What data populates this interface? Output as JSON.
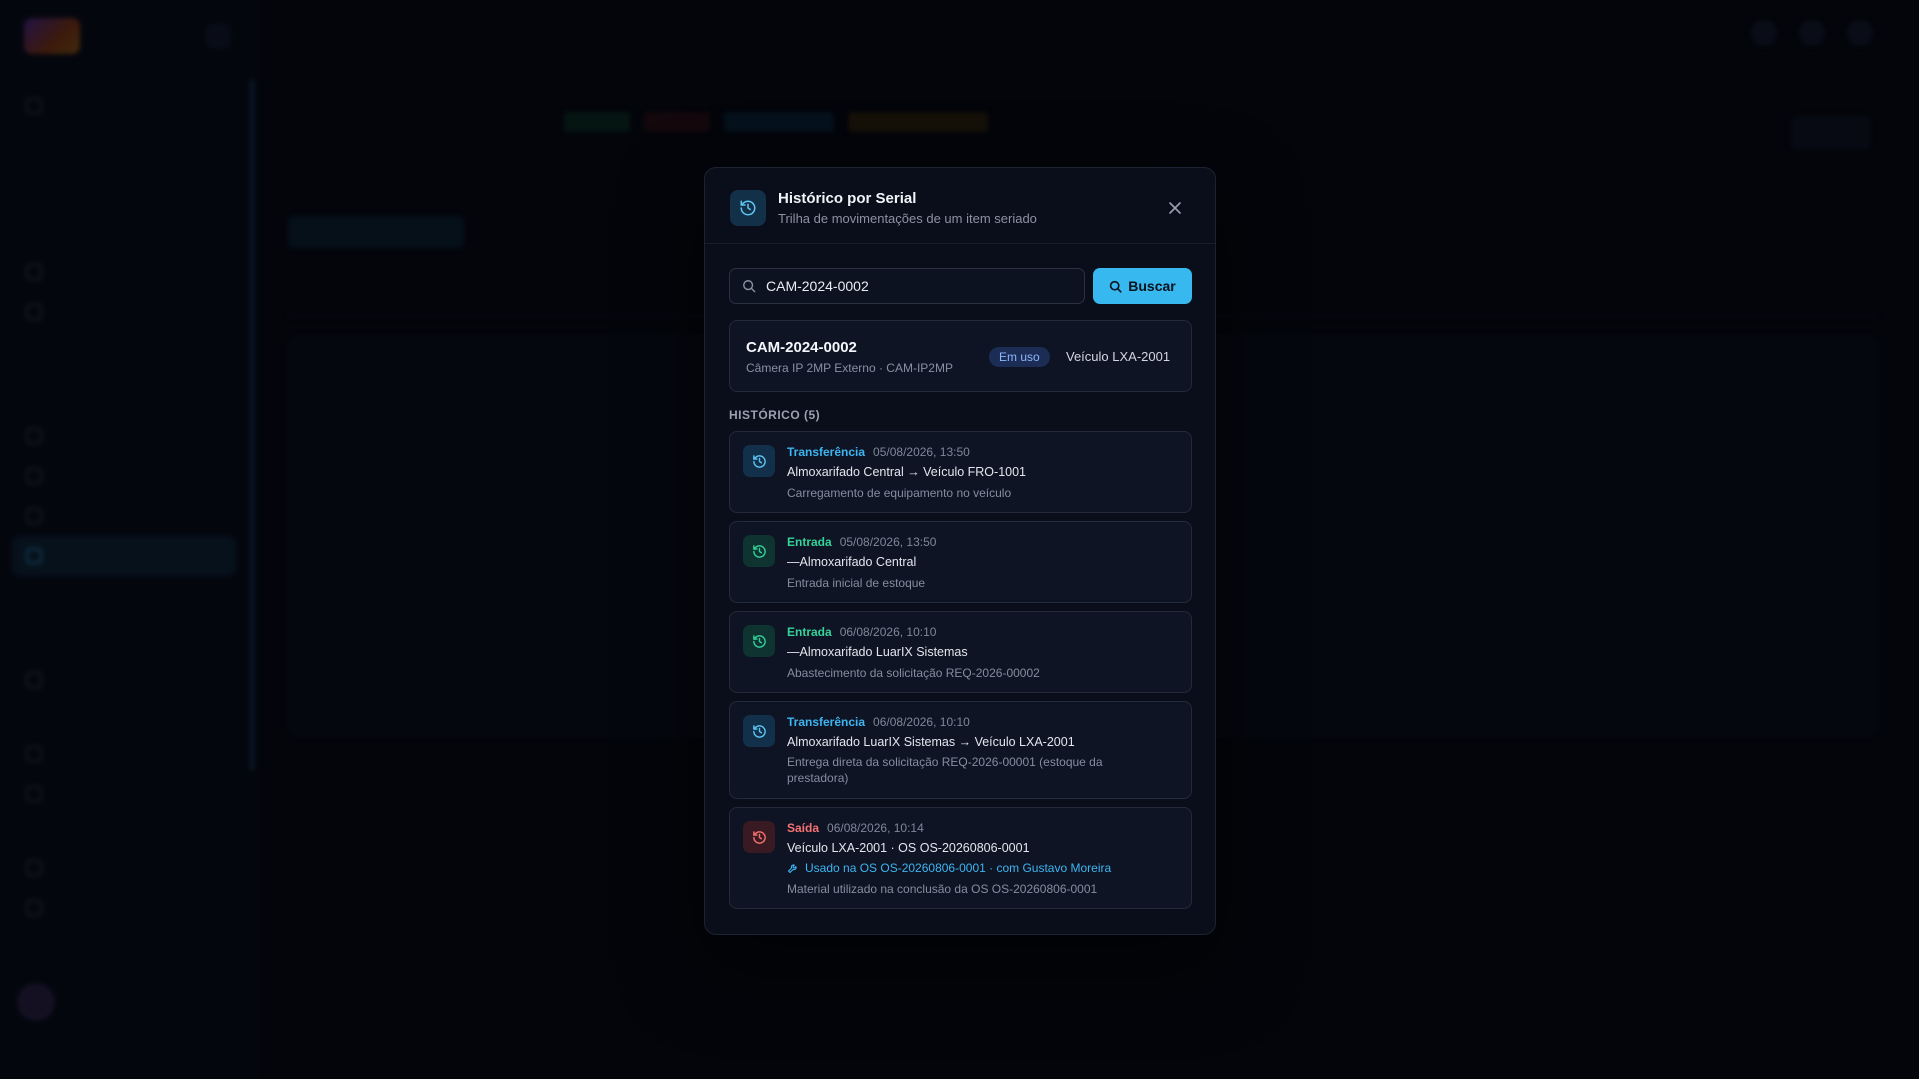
{
  "modal": {
    "title": "Histórico por Serial",
    "subtitle": "Trilha de movimentações de um item seriado",
    "icon": "history-icon",
    "close_icon": "close-icon"
  },
  "search": {
    "value": "CAM-2024-0002",
    "button_label": "Buscar",
    "icon": "search-icon"
  },
  "serial": {
    "code": "CAM-2024-0002",
    "description": "Câmera IP 2MP Externo · CAM-IP2MP",
    "status": "Em uso",
    "location": "Veículo LXA-2001"
  },
  "history": {
    "title": "HISTÓRICO (5)",
    "items": [
      {
        "type": "Transferência",
        "date": "05/08/2026, 13:50",
        "route": "Almoxarifado Central → Veículo FRO-1001",
        "note": "Carregamento de equipamento no veículo",
        "color": "#3db5f0"
      },
      {
        "type": "Entrada",
        "date": "05/08/2026, 13:50",
        "route": "—Almoxarifado Central",
        "note": "Entrada inicial de estoque",
        "color": "#34d399"
      },
      {
        "type": "Entrada",
        "date": "06/08/2026, 10:10",
        "route": "—Almoxarifado LuarIX Sistemas",
        "note": "Abastecimento da solicitação REQ-2026-00002",
        "color": "#34d399"
      },
      {
        "type": "Transferência",
        "date": "06/08/2026, 10:10",
        "route": "Almoxarifado LuarIX Sistemas → Veículo LXA-2001",
        "note": "Entrega direta da solicitação REQ-2026-00001 (estoque da prestadora)",
        "color": "#3db5f0"
      },
      {
        "type": "Saída",
        "date": "06/08/2026, 10:14",
        "route": "Veículo LXA-2001 · OS OS-20260806-0001",
        "link": "Usado na OS OS-20260806-0001 · com Gustavo Moreira",
        "note": "Material utilizado na conclusão da OS OS-20260806-0001",
        "color": "#f87171"
      }
    ]
  },
  "colors": {
    "accent": "#37b8ee",
    "transfer": "#3db5f0",
    "entry": "#34d399",
    "exit": "#f87171",
    "badge_bg": "#1b2d55"
  }
}
